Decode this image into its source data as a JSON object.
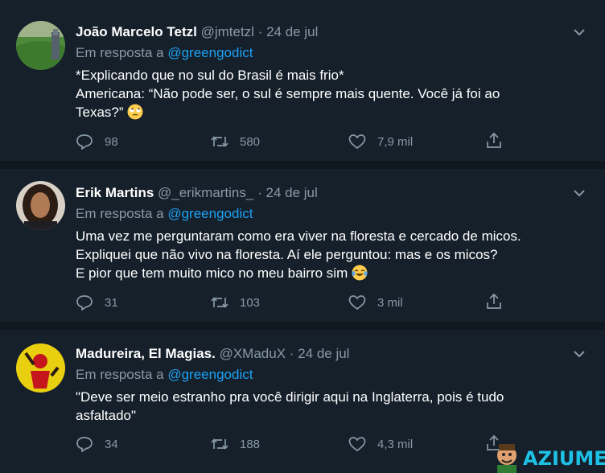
{
  "tweets": [
    {
      "name": "João Marcelo Tetzl",
      "handle": "@jmtetzl",
      "date": "24 de jul",
      "reply_prefix": "Em resposta a",
      "reply_to": "@greengodict",
      "lines": [
        "*Explicando que no sul do Brasil é mais frio*",
        "Americana: “Não pode ser, o sul é sempre mais quente. Você já foi ao",
        "Texas?”"
      ],
      "emoji": "rolling-eyes",
      "replies": "98",
      "retweets": "580",
      "likes": "7,9 mil"
    },
    {
      "name": "Erik Martins",
      "handle": "@_erikmartins_",
      "date": "24 de jul",
      "reply_prefix": "Em resposta a",
      "reply_to": "@greengodict",
      "lines": [
        "Uma vez me perguntaram como era viver na floresta e cercado de micos.",
        "Expliquei que não vivo na floresta. Aí ele perguntou: mas e os micos?",
        "E pior que tem muito mico no meu bairro sim"
      ],
      "emoji": "tears-of-joy",
      "replies": "31",
      "retweets": "103",
      "likes": "3 mil"
    },
    {
      "name": "Madureira, El Magias.",
      "handle": "@XMaduX",
      "date": "24 de jul",
      "reply_prefix": "Em resposta a",
      "reply_to": "@greengodict",
      "lines": [
        "\"Deve ser meio estranho pra você dirigir aqui na Inglaterra, pois é tudo",
        "asfaltado\""
      ],
      "replies": "34",
      "retweets": "188",
      "likes": "4,3 mil"
    }
  ],
  "separator": "·",
  "watermark": "AZIUME",
  "colors": {
    "background": "#15202b",
    "secondary_text": "#8899a6",
    "link": "#1da1f2",
    "divider": "#10171e"
  }
}
